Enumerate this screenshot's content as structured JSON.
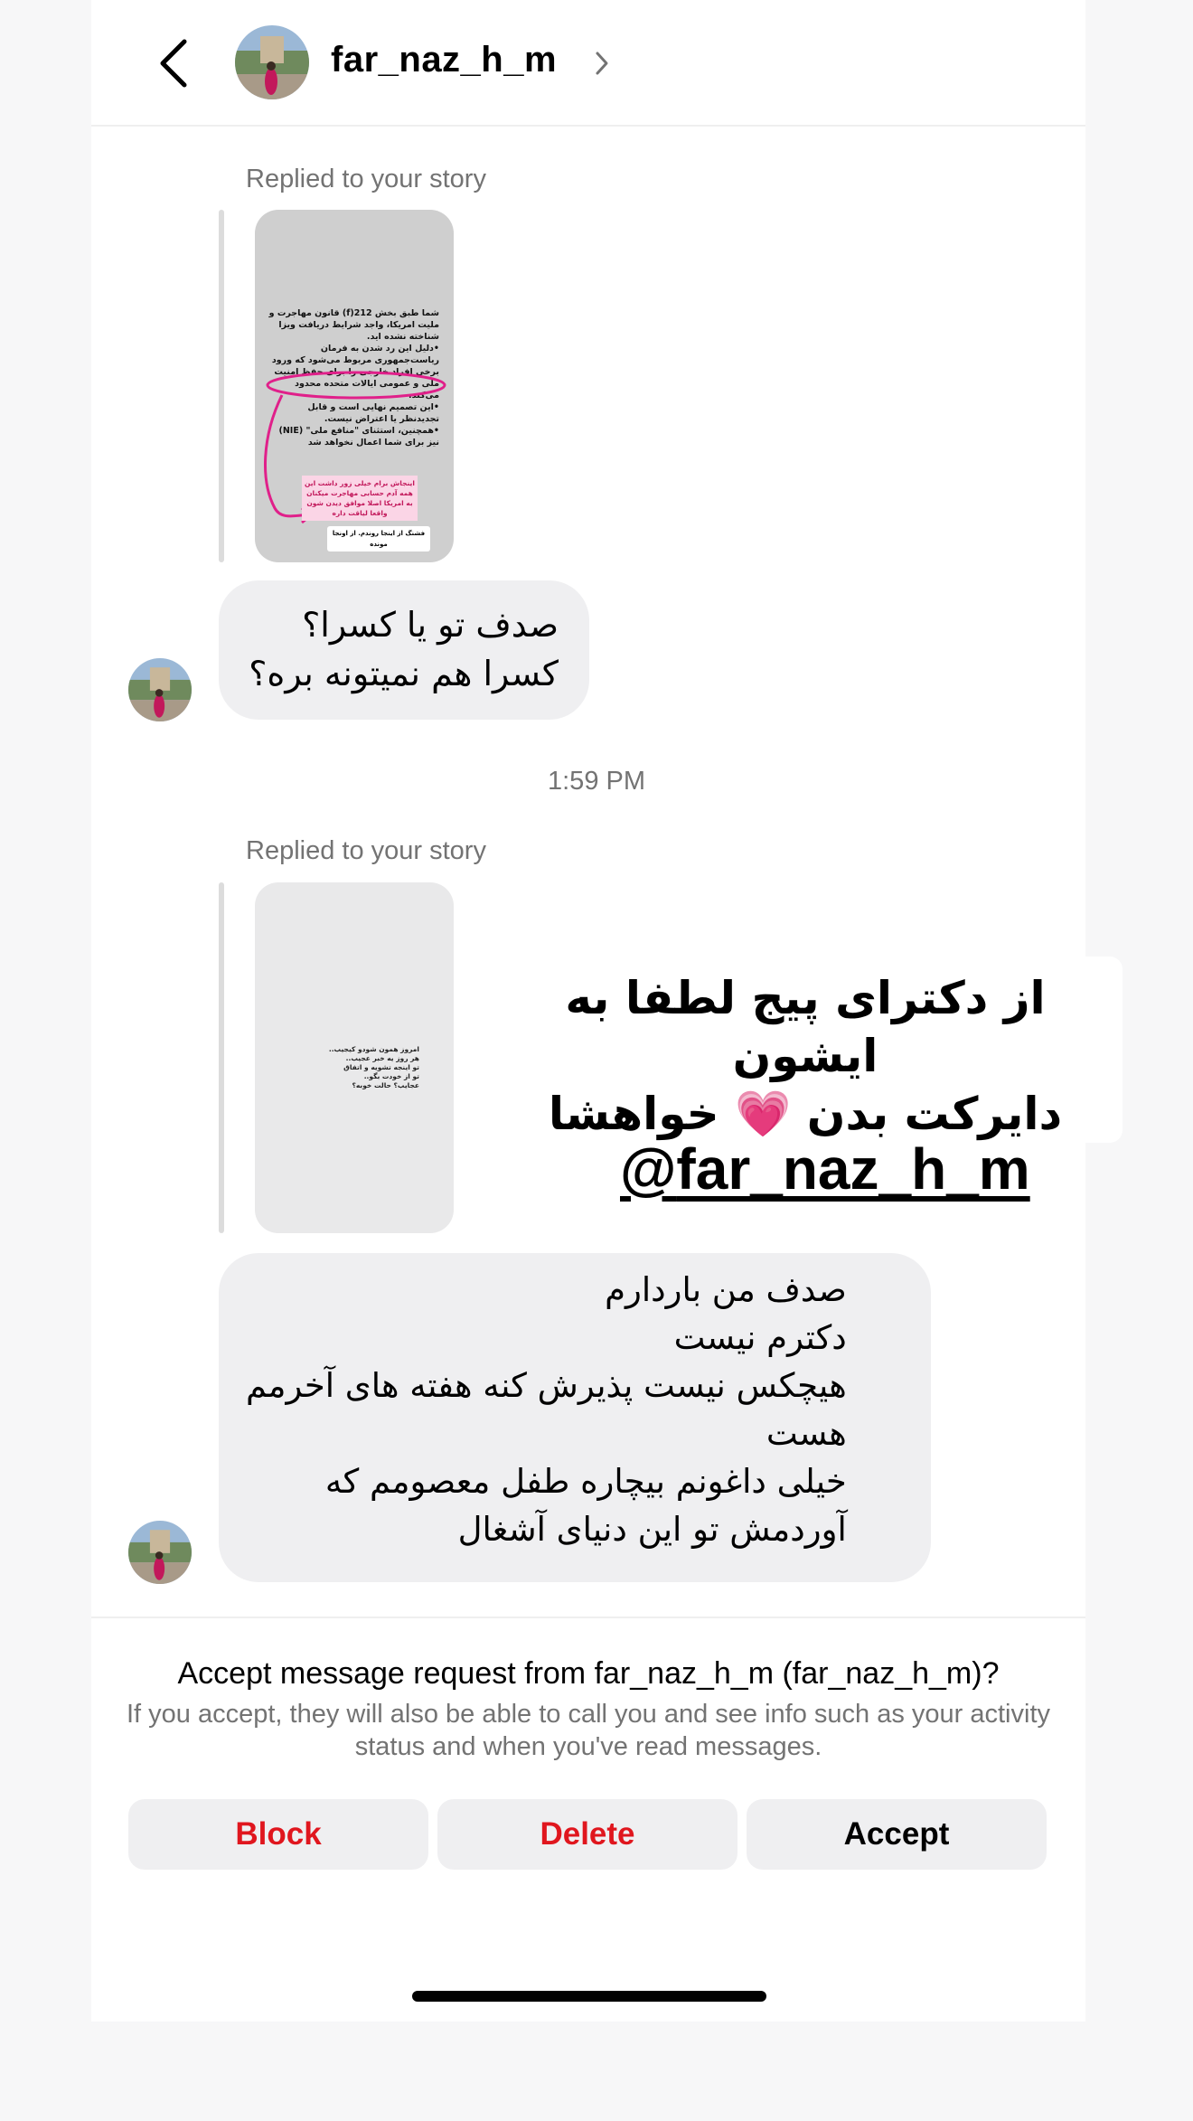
{
  "header": {
    "username": "far_naz_h_m"
  },
  "thread": {
    "replied_label_1": "Replied to your story",
    "story1_text": {
      "p1": "شما طبق بخش 212(f) قانون مهاجرت و ملیت امریکا، واجد شرایط دریافت ویزا شناخته نشده اید.",
      "p2": "•دلیل این رد شدن به فرمان ریاست‌جمهوری مربوط می‌شود که ورود برخی افراد خارجی را برای حفظ امنیت ملی و عمومی ایالات متحده محدود می‌کند.",
      "p3": "•این تصمیم نهایی است و قابل تجدیدنظر یا اعتراض نیست.",
      "p4": "•همچنین، استثنای \"منافع ملی\" (NIE) نیز برای شما اعمال نخواهد شد",
      "pink": "اینجاش برام خیلی زور داشت این همه آدم حسابی مهاجرت میکنان به امریکا اصلا موافق دیدن شون واقعا لیاقت داره",
      "white": "فشنگ از اینجا روندم. از اونجا مونده"
    },
    "message1": {
      "lines": [
        "صدف تو یا کسرا؟",
        "کسرا هم نمیتونه بره؟"
      ]
    },
    "timestamp": "1:59 PM",
    "replied_label_2": "Replied to your story",
    "story2_text": {
      "lines": [
        "امروز همون شودو کیجیب..",
        "هر روز یه خبر عجیب..",
        "تو اینجه تشویه و اتفاق",
        "تو از خودت بگو..",
        "عجایب؟ حالت خوبه؟"
      ]
    },
    "overlay": {
      "line1": "از دکترای پیج لطفا به ایشون",
      "line2": "دایرکت بدن",
      "heart": "💗",
      "line2b": "خواهشا",
      "handle_symbol": "@",
      "handle": "far_naz_h_m"
    },
    "message2": {
      "lines": [
        "صدف من باردارم",
        "دکترم نیست",
        "هیچکس نیست پذیرش کنه هفته های آخرمم",
        "هست",
        "خیلی داغونم بیچاره طفل معصومم که",
        "آوردمش تو این دنیای آشغال"
      ]
    }
  },
  "request": {
    "title": "Accept message request from far_naz_h_m (far_naz_h_m)?",
    "subtitle": "If you accept, they will also be able to call you and see info such as your activity status and when you've read messages.",
    "block_label": "Block",
    "delete_label": "Delete",
    "accept_label": "Accept"
  },
  "colors": {
    "danger": "#e0161e",
    "muted": "#737373",
    "bubble": "#efeff1",
    "highlight_pink": "#e0208a"
  }
}
